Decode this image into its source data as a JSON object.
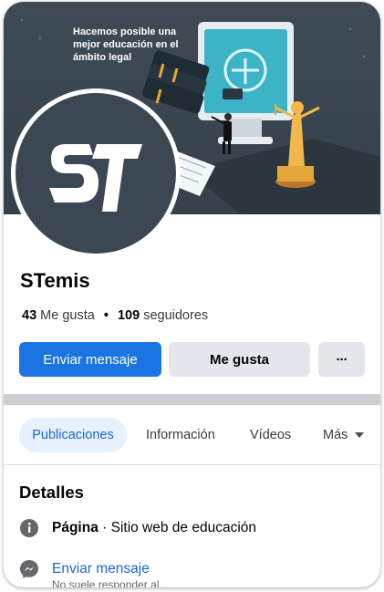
{
  "cover": {
    "headline": "Hacemos posible una\nmejor educación en el\námbito legal"
  },
  "page": {
    "name": "STemis",
    "likes_count": "43",
    "likes_label": "Me gusta",
    "followers_count": "109",
    "followers_label": "seguidores"
  },
  "actions": {
    "message_label": "Enviar mensaje",
    "like_label": "Me gusta",
    "more_label": "···"
  },
  "tabs": [
    {
      "label": "Publicaciones"
    },
    {
      "label": "Información"
    },
    {
      "label": "Vídeos"
    },
    {
      "label": "Más"
    }
  ],
  "details": {
    "title": "Detalles",
    "category_bold": "Página",
    "category_rest": " · Sitio web de educación",
    "message_link": "Enviar mensaje",
    "message_sub": "No suele responder al..."
  },
  "colors": {
    "primary": "#1b74e4",
    "secondary_button": "#e4e6eb",
    "active_tab_bg": "#e7f0fd",
    "cover_bg": "#3e4b55",
    "accent_gold": "#e6a73a",
    "accent_cyan": "#3bb4c8"
  },
  "icons": {
    "info": "info-circle-icon",
    "messenger": "messenger-icon",
    "more": "more-horizontal-icon",
    "dropdown": "caret-down-icon"
  }
}
